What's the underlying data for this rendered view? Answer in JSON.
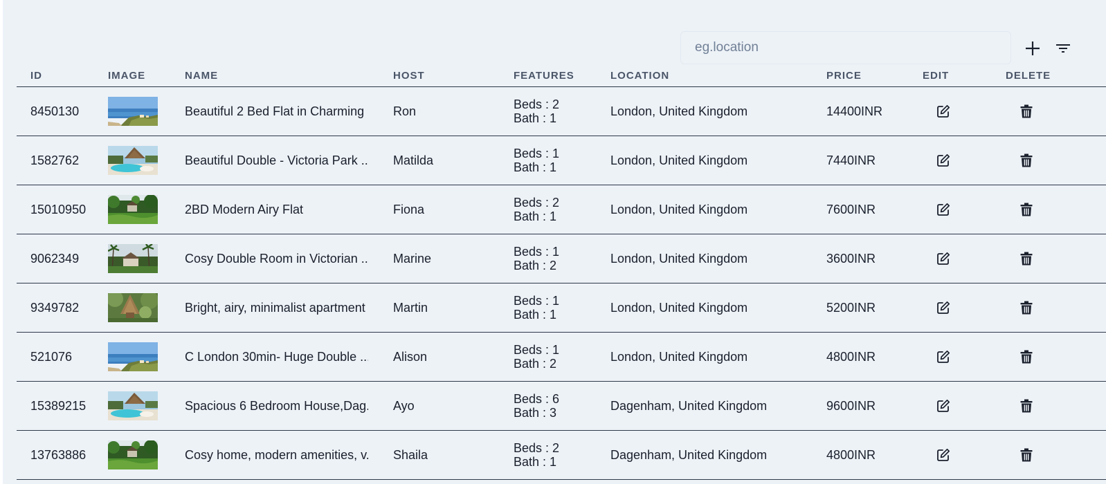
{
  "search": {
    "placeholder": "eg.location",
    "value": ""
  },
  "toolbar": {
    "add_icon": "plus-icon",
    "filter_icon": "filter-icon"
  },
  "columns": [
    "ID",
    "IMAGE",
    "NAME",
    "HOST",
    "FEATURES",
    "LOCATION",
    "PRICE",
    "EDIT",
    "DELETE"
  ],
  "rows": [
    {
      "id": "8450130",
      "image": "sea-cliff",
      "name": "Beautiful 2 Bed Flat in Charming ...",
      "host": "Ron",
      "beds": "Beds : 2",
      "bath": "Bath : 1",
      "location": "London, United Kingdom",
      "price": "14400INR"
    },
    {
      "id": "1582762",
      "image": "pool-resort",
      "name": "Beautiful Double - Victoria Park ...",
      "host": "Matilda",
      "beds": "Beds : 1",
      "bath": "Bath : 1",
      "location": "London, United Kingdom",
      "price": "7440INR"
    },
    {
      "id": "15010950",
      "image": "jungle",
      "name": "2BD Modern Airy Flat",
      "host": "Fiona",
      "beds": "Beds : 2",
      "bath": "Bath : 1",
      "location": "London, United Kingdom",
      "price": "7600INR"
    },
    {
      "id": "9062349",
      "image": "palm-villa",
      "name": "Cosy Double Room in Victorian ...",
      "host": "Marine",
      "beds": "Beds : 1",
      "bath": "Bath : 2",
      "location": "London, United Kingdom",
      "price": "3600INR"
    },
    {
      "id": "9349782",
      "image": "thatched-hut",
      "name": "Bright, airy, minimalist apartment",
      "host": "Martin",
      "beds": "Beds : 1",
      "bath": "Bath : 1",
      "location": "London, United Kingdom",
      "price": "5200INR"
    },
    {
      "id": "521076",
      "image": "sea-cliff",
      "name": "C London 30min- Huge Double ...",
      "host": "Alison",
      "beds": "Beds : 1",
      "bath": "Bath : 2",
      "location": "London, United Kingdom",
      "price": "4800INR"
    },
    {
      "id": "15389215",
      "image": "pool-resort",
      "name": "Spacious 6 Bedroom House,Dag...",
      "host": "Ayo",
      "beds": "Beds : 6",
      "bath": "Bath : 3",
      "location": "Dagenham, United Kingdom",
      "price": "9600INR"
    },
    {
      "id": "13763886",
      "image": "jungle",
      "name": "Cosy home, modern amenities, v...",
      "host": "Shaila",
      "beds": "Beds : 2",
      "bath": "Bath : 1",
      "location": "Dagenham, United Kingdom",
      "price": "4800INR"
    }
  ],
  "icons": {
    "edit": "edit-icon",
    "delete": "trash-icon"
  }
}
